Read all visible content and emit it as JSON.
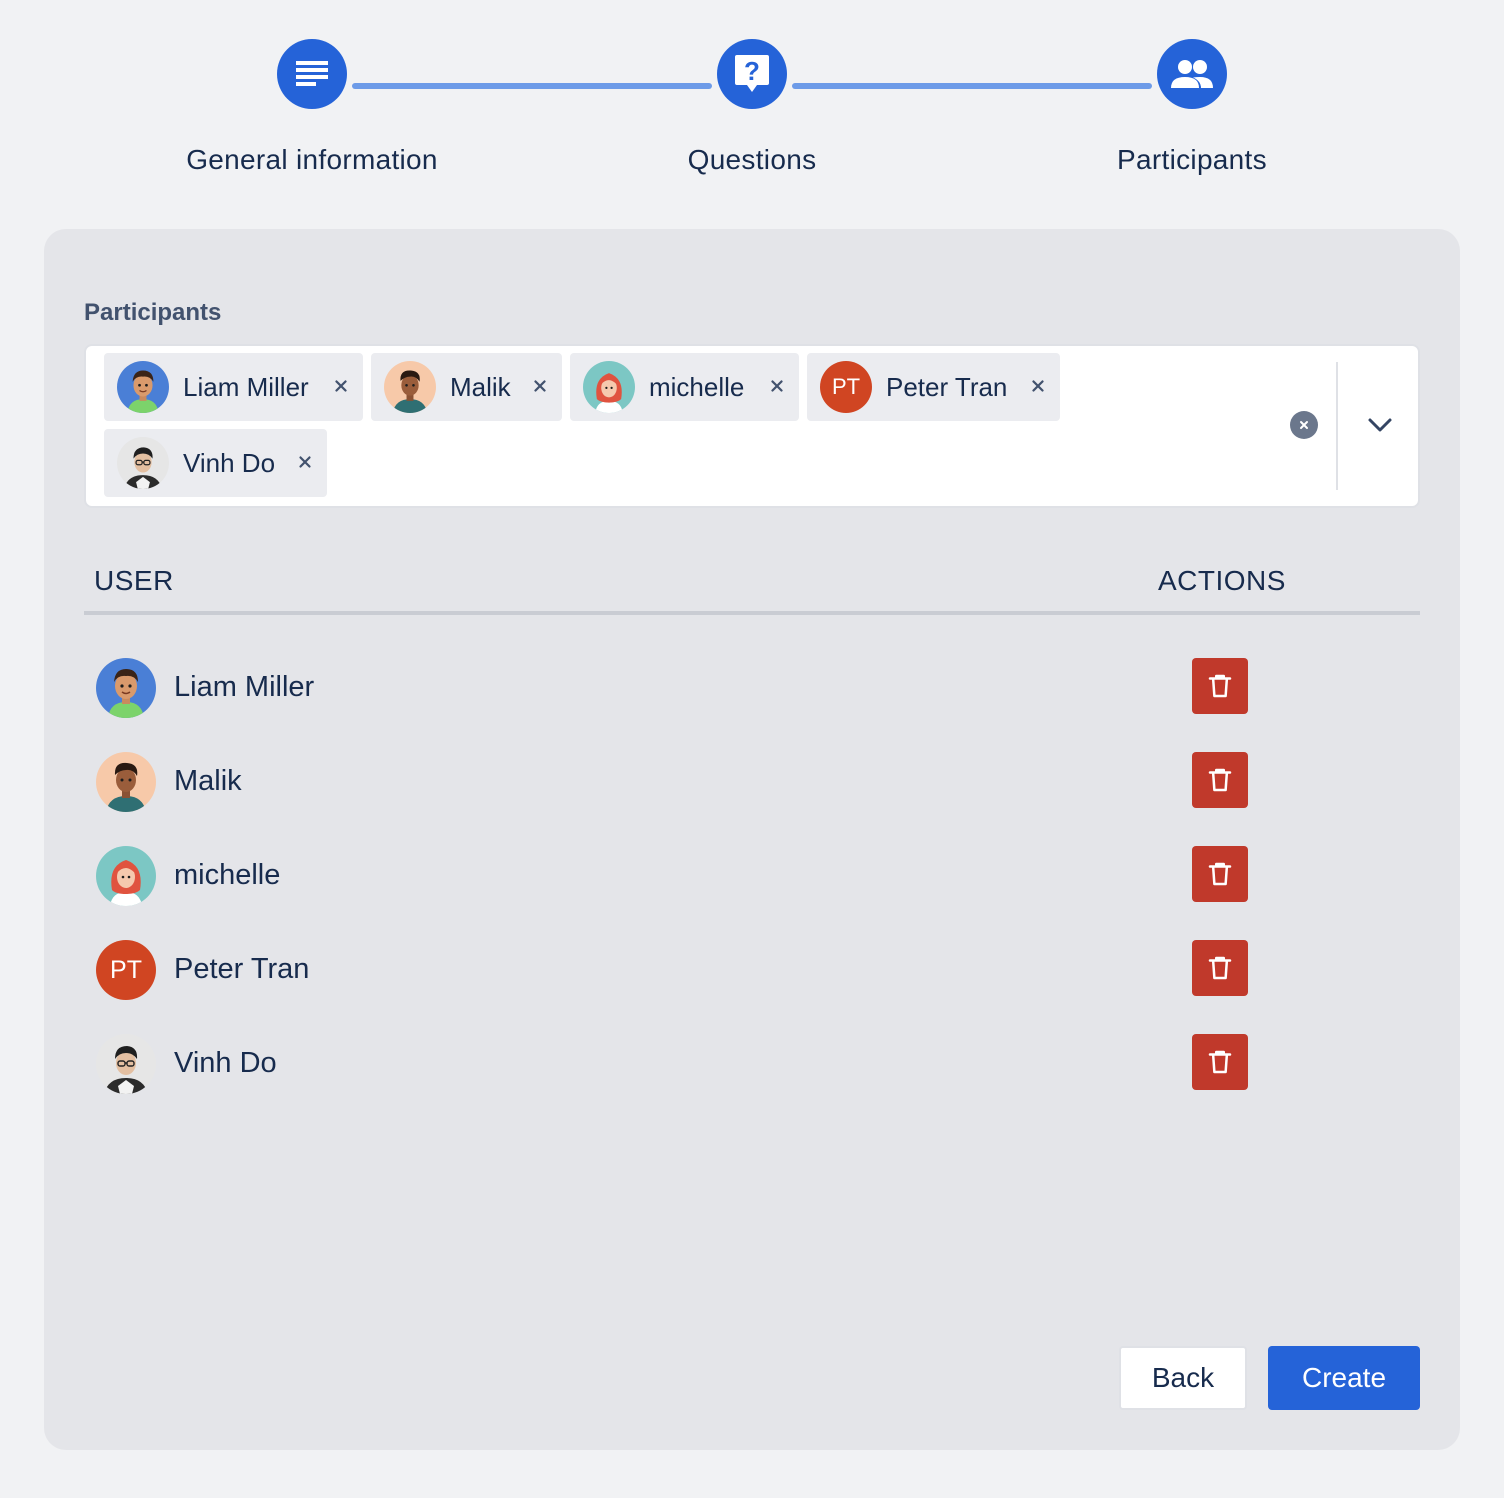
{
  "stepper": {
    "steps": [
      {
        "label": "General information",
        "icon": "document-lines-icon"
      },
      {
        "label": "Questions",
        "icon": "question-bubble-icon"
      },
      {
        "label": "Participants",
        "icon": "people-icon"
      }
    ],
    "accent_color": "#2563d8",
    "connector_color": "#6d9be8"
  },
  "participants_field": {
    "label": "Participants",
    "selected": [
      {
        "name": "Liam Miller",
        "avatar": "liam-avatar"
      },
      {
        "name": "Malik",
        "avatar": "malik-avatar"
      },
      {
        "name": "michelle",
        "avatar": "michelle-avatar"
      },
      {
        "name": "Peter Tran",
        "avatar": "initials",
        "initials": "PT"
      },
      {
        "name": "Vinh Do",
        "avatar": "vinh-avatar"
      }
    ],
    "remove_icon": "close-icon",
    "clear_icon": "clear-circle-icon",
    "toggle_icon": "chevron-down-icon"
  },
  "table": {
    "headers": {
      "user": "USER",
      "actions": "ACTIONS"
    },
    "rows": [
      {
        "name": "Liam Miller",
        "avatar": "liam-avatar"
      },
      {
        "name": "Malik",
        "avatar": "malik-avatar"
      },
      {
        "name": "michelle",
        "avatar": "michelle-avatar"
      },
      {
        "name": "Peter Tran",
        "avatar": "initials",
        "initials": "PT"
      },
      {
        "name": "Vinh Do",
        "avatar": "vinh-avatar"
      }
    ],
    "delete_icon": "trash-icon",
    "delete_color": "#c0392b"
  },
  "footer": {
    "back_label": "Back",
    "create_label": "Create"
  }
}
